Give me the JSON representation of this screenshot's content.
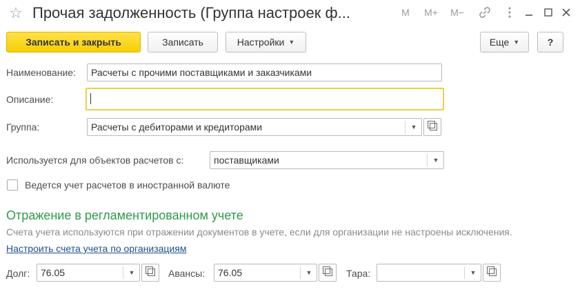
{
  "window": {
    "title": "Прочая задолженность (Группа настроек ф...",
    "star_icon": "star-icon",
    "memory_buttons": [
      "M",
      "M+",
      "M−"
    ],
    "link_icon": "link-icon",
    "menu_icon": "more-vertical-icon",
    "minimize_icon": "minimize-icon",
    "maximize_icon": "maximize-icon",
    "close_icon": "close-icon"
  },
  "toolbar": {
    "save_close_label": "Записать и закрыть",
    "save_label": "Записать",
    "settings_label": "Настройки",
    "more_label": "Еще",
    "help_label": "?"
  },
  "form": {
    "name_label": "Наименование:",
    "name_value": "Расчеты с прочими поставщиками и заказчиками",
    "description_label": "Описание:",
    "description_value": "",
    "group_label": "Группа:",
    "group_value": "Расчеты с дебиторами и кредиторами",
    "used_for_label": "Используется для объектов расчетов с:",
    "used_for_value": "поставщиками",
    "foreign_currency_label": "Ведется учет расчетов в иностранной валюте",
    "foreign_currency_checked": false
  },
  "accounting": {
    "section_title": "Отражение в регламентированном учете",
    "hint": "Счета учета используются при отражении документов в учете, если для организации не настроены исключения.",
    "link": "Настроить счета учета по организациям",
    "debt_label": "Долг:",
    "debt_value": "76.05",
    "advances_label": "Авансы:",
    "advances_value": "76.05",
    "tara_label": "Тара:",
    "tara_value": ""
  },
  "colors": {
    "primary_button": "#f5d000",
    "section_title": "#2f9a4a",
    "link": "#1f4e8c",
    "focus_border": "#e8d04a"
  }
}
